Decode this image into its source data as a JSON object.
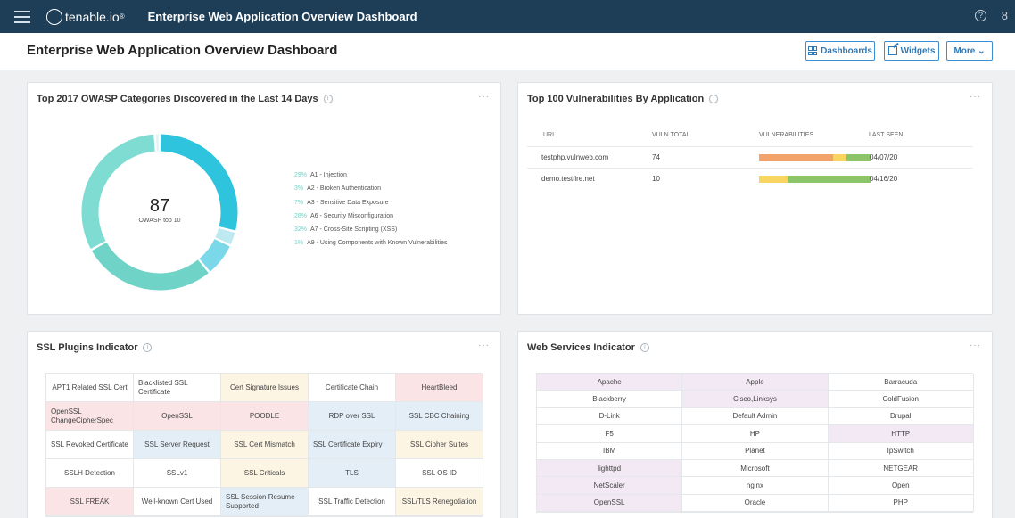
{
  "topbar": {
    "logo_text": "tenable.io",
    "title": "Enterprise Web Application Overview Dashboard",
    "help_icon": "?",
    "user_icon": "8"
  },
  "header": {
    "title": "Enterprise Web Application Overview Dashboard",
    "dashboards_label": "Dashboards",
    "widgets_label": "Widgets",
    "more_label": "More ⌄"
  },
  "colors": {
    "topbar": "#1e3d57",
    "accent": "#3b8ed1",
    "donut_teal": "#6fd3c8",
    "donut_cyan": "#2ec4dd",
    "bar_orange": "#f2a36b",
    "bar_yellow": "#f7d560",
    "bar_green": "#8cc46a",
    "cell_pink": "#fbe4e6",
    "cell_blue": "#e3eef7",
    "cell_yellow": "#fdf5e4",
    "cell_purple": "#f3e9f5"
  },
  "owasp": {
    "title": "Top 2017 OWASP Categories Discovered in the Last 14 Days",
    "total": "87",
    "subtitle": "OWASP top 10",
    "menu": "···",
    "legend": [
      {
        "pct": "29%",
        "label": "A1 - Injection",
        "value": 29,
        "color": "#2ec4dd"
      },
      {
        "pct": "3%",
        "label": "A2 - Broken Authentication",
        "value": 3,
        "color": "#bfe9f1"
      },
      {
        "pct": "7%",
        "label": "A3 - Sensitive Data Exposure",
        "value": 7,
        "color": "#7ad8e8"
      },
      {
        "pct": "28%",
        "label": "A6 - Security Misconfiguration",
        "value": 28,
        "color": "#6fd3c8"
      },
      {
        "pct": "32%",
        "label": "A7 - Cross-Site Scripting (XSS)",
        "value": 32,
        "color": "#7fdcd2"
      },
      {
        "pct": "1%",
        "label": "A9 - Using Components with Known Vulnerabilities",
        "value": 1,
        "color": "#e0f5f3"
      }
    ]
  },
  "vulns": {
    "title": "Top 100 Vulnerabilities By Application",
    "menu": "···",
    "columns": [
      "URI",
      "VULN TOTAL",
      "VULNERABILITIES",
      "LAST SEEN"
    ],
    "rows": [
      {
        "uri": "testphp.vulnweb.com",
        "total": "74",
        "last_seen": "04/07/20",
        "segments": [
          0.66,
          0.12,
          0.22
        ]
      },
      {
        "uri": "demo.testfire.net",
        "total": "10",
        "last_seen": "04/16/20",
        "segments": [
          0.0,
          0.26,
          0.74
        ]
      }
    ]
  },
  "ssl": {
    "title": "SSL Plugins Indicator",
    "menu": "···",
    "cells": [
      {
        "label": "APT1 Related SSL Cert",
        "tone": "white"
      },
      {
        "label": "Blacklisted SSL Certificate",
        "tone": "white"
      },
      {
        "label": "Cert Signature Issues",
        "tone": "yellow"
      },
      {
        "label": "Certificate Chain",
        "tone": "white"
      },
      {
        "label": "HeartBleed",
        "tone": "pink"
      },
      {
        "label": "OpenSSL ChangeCipherSpec",
        "tone": "pink"
      },
      {
        "label": "OpenSSL",
        "tone": "pink"
      },
      {
        "label": "POODLE",
        "tone": "pink"
      },
      {
        "label": "RDP over SSL",
        "tone": "blue"
      },
      {
        "label": "SSL CBC Chaining",
        "tone": "blue"
      },
      {
        "label": "SSL Revoked Certificate",
        "tone": "white"
      },
      {
        "label": "SSL Server Request",
        "tone": "blue"
      },
      {
        "label": "SSL Cert Mismatch",
        "tone": "yellow"
      },
      {
        "label": "SSL Certificate Expiry",
        "tone": "blue"
      },
      {
        "label": "SSL Cipher Suites",
        "tone": "yellow"
      },
      {
        "label": "SSLH Detection",
        "tone": "white"
      },
      {
        "label": "SSLv1",
        "tone": "white"
      },
      {
        "label": "SSL Criticals",
        "tone": "yellow"
      },
      {
        "label": "TLS",
        "tone": "blue"
      },
      {
        "label": "SSL OS ID",
        "tone": "white"
      },
      {
        "label": "SSL FREAK",
        "tone": "pink"
      },
      {
        "label": "Well-known Cert Used",
        "tone": "white"
      },
      {
        "label": "SSL Session Resume Supported",
        "tone": "blue"
      },
      {
        "label": "SSL Traffic Detection",
        "tone": "white"
      },
      {
        "label": "SSL/TLS Renegotiation",
        "tone": "yellow"
      }
    ]
  },
  "web": {
    "title": "Web Services Indicator",
    "menu": "···",
    "cells": [
      {
        "label": "Apache",
        "tone": "purple"
      },
      {
        "label": "Apple",
        "tone": "purple"
      },
      {
        "label": "Barracuda",
        "tone": "white"
      },
      {
        "label": "Blackberry",
        "tone": "white"
      },
      {
        "label": "Cisco,Linksys",
        "tone": "purple"
      },
      {
        "label": "ColdFusion",
        "tone": "white"
      },
      {
        "label": "D-Link",
        "tone": "white"
      },
      {
        "label": "Default Admin",
        "tone": "white"
      },
      {
        "label": "Drupal",
        "tone": "white"
      },
      {
        "label": "F5",
        "tone": "white"
      },
      {
        "label": "HP",
        "tone": "white"
      },
      {
        "label": "HTTP",
        "tone": "purple"
      },
      {
        "label": "IBM",
        "tone": "white"
      },
      {
        "label": "Planet",
        "tone": "white"
      },
      {
        "label": "IpSwitch",
        "tone": "white"
      },
      {
        "label": "lighttpd",
        "tone": "purple"
      },
      {
        "label": "Microsoft",
        "tone": "white"
      },
      {
        "label": "NETGEAR",
        "tone": "white"
      },
      {
        "label": "NetScaler",
        "tone": "purple"
      },
      {
        "label": "nginx",
        "tone": "white"
      },
      {
        "label": "Open",
        "tone": "white"
      },
      {
        "label": "OpenSSL",
        "tone": "purple"
      },
      {
        "label": "Oracle",
        "tone": "white"
      },
      {
        "label": "PHP",
        "tone": "white"
      }
    ]
  }
}
